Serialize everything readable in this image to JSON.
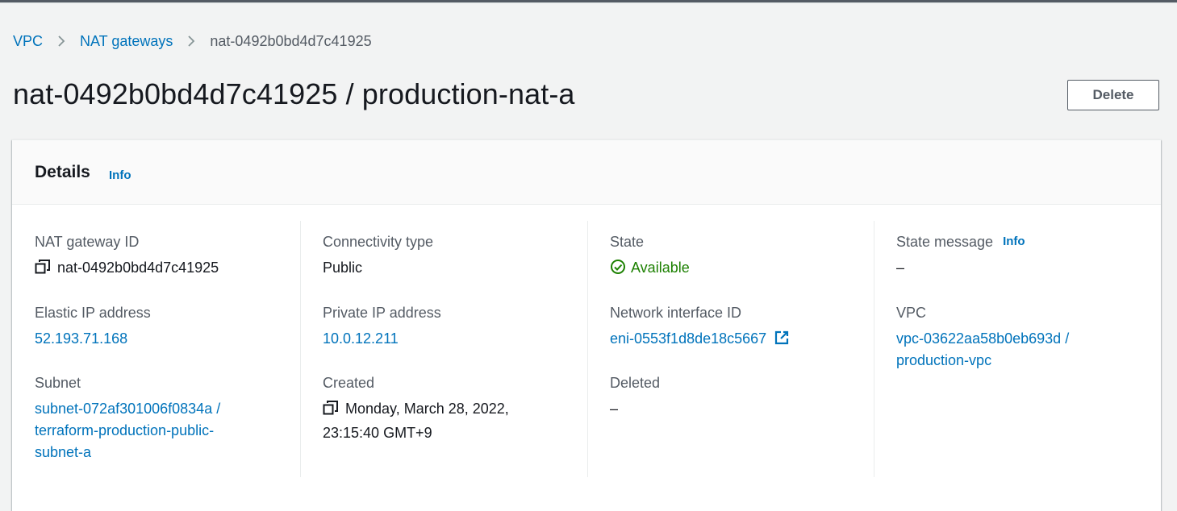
{
  "breadcrumb": {
    "items": [
      "VPC",
      "NAT gateways"
    ],
    "current": "nat-0492b0bd4d7c41925"
  },
  "page": {
    "title": "nat-0492b0bd4d7c41925 / production-nat-a",
    "delete_label": "Delete"
  },
  "details": {
    "title": "Details",
    "info_label": "Info",
    "fields": {
      "nat_gateway_id": {
        "label": "NAT gateway ID",
        "value": "nat-0492b0bd4d7c41925",
        "icon": "copy-icon"
      },
      "elastic_ip": {
        "label": "Elastic IP address",
        "value": "52.193.71.168"
      },
      "subnet": {
        "label": "Subnet",
        "value": "subnet-072af301006f0834a / terraform-production-public-subnet-a"
      },
      "connectivity_type": {
        "label": "Connectivity type",
        "value": "Public"
      },
      "private_ip": {
        "label": "Private IP address",
        "value": "10.0.12.211"
      },
      "created": {
        "label": "Created",
        "value": "Monday, March 28, 2022, 23:15:40 GMT+9",
        "icon": "copy-icon"
      },
      "state": {
        "label": "State",
        "value": "Available",
        "icon": "check-circle-icon",
        "color": "#1d8102"
      },
      "network_interface": {
        "label": "Network interface ID",
        "value": "eni-0553f1d8de18c5667",
        "icon": "external-link-icon"
      },
      "deleted": {
        "label": "Deleted",
        "value": "–"
      },
      "state_message": {
        "label": "State message",
        "info_label": "Info",
        "value": "–"
      },
      "vpc": {
        "label": "VPC",
        "value": "vpc-03622aa58b0eb693d / production-vpc"
      }
    }
  },
  "colors": {
    "link": "#0073bb",
    "success": "#1d8102",
    "text": "#16191f",
    "muted": "#545b64"
  }
}
